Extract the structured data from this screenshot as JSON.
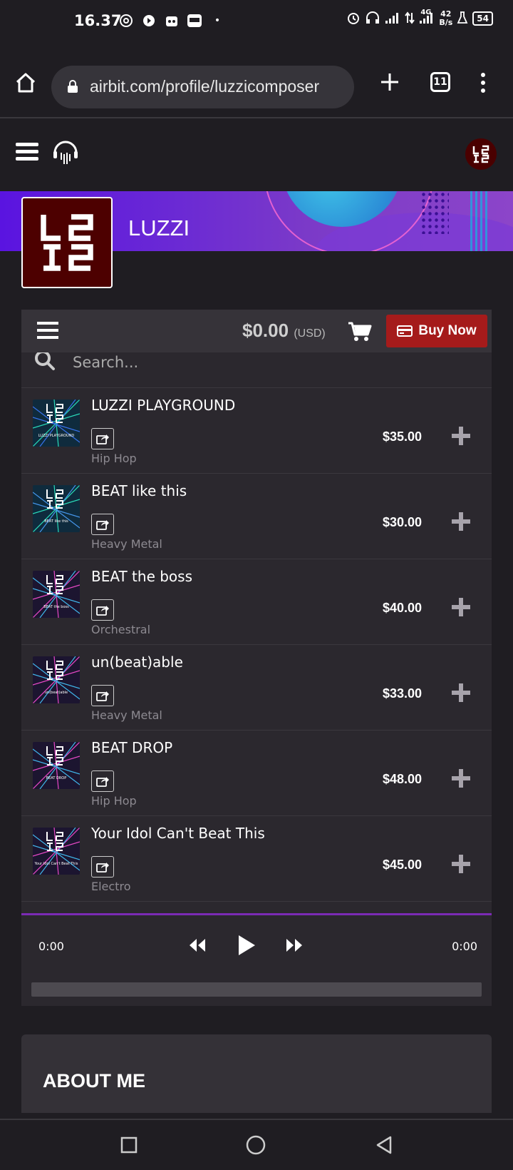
{
  "status_bar": {
    "time": "16.37",
    "network_type": "4G",
    "net_speed_value": "42",
    "net_speed_unit": "B/s",
    "battery": "54"
  },
  "browser": {
    "url": "airbit.com/profile/luzzicomposer",
    "tab_count": "11"
  },
  "profile": {
    "name": "LUZZI"
  },
  "store": {
    "cart_total": "$0.00",
    "currency": "(USD)",
    "buy_now_label": "Buy Now",
    "search_placeholder": "Search...",
    "tracks": [
      {
        "title": "LUZZI PLAYGROUND",
        "genre": "Hip Hop",
        "price": "$35.00",
        "thumb_caption": "LUZZI PLAYGROUND"
      },
      {
        "title": "BEAT like this",
        "genre": "Heavy Metal",
        "price": "$30.00",
        "thumb_caption": "BEAT like this"
      },
      {
        "title": "BEAT the boss",
        "genre": "Orchestral",
        "price": "$40.00",
        "thumb_caption": "BEAT the boss"
      },
      {
        "title": "un(beat)able",
        "genre": "Heavy Metal",
        "price": "$33.00",
        "thumb_caption": "un(beat)able"
      },
      {
        "title": "BEAT DROP",
        "genre": "Hip Hop",
        "price": "$48.00",
        "thumb_caption": "BEAT DROP"
      },
      {
        "title": "Your Idol Can't Beat This",
        "genre": "Electro",
        "price": "$45.00",
        "thumb_caption": "Your Idol Can't Beat This"
      }
    ]
  },
  "player": {
    "elapsed": "0:00",
    "duration": "0:00",
    "progress_fraction": 0
  },
  "about": {
    "title": "ABOUT ME"
  },
  "colors": {
    "background": "#1f1d22",
    "panel": "#2b282e",
    "buy_now": "#a51b1b",
    "accent_purple": "#7b2bb5",
    "avatar": "#4d0000"
  }
}
